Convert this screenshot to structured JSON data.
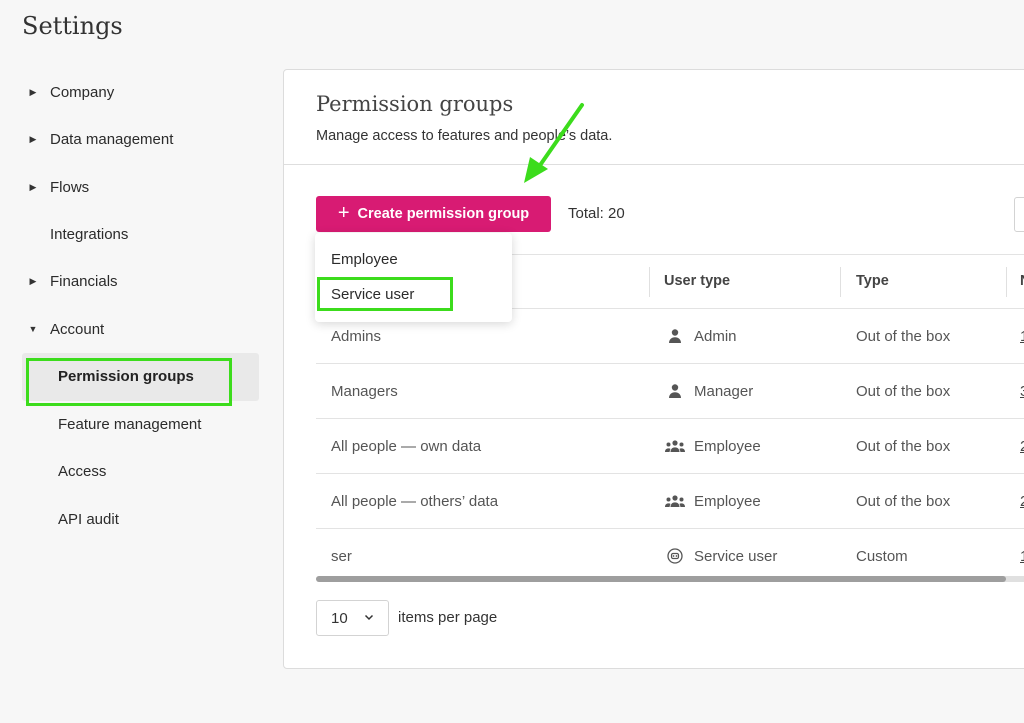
{
  "page": {
    "title": "Settings"
  },
  "sidebar": {
    "items": [
      {
        "label": "Company",
        "expandable": true
      },
      {
        "label": "Data management",
        "expandable": true
      },
      {
        "label": "Flows",
        "expandable": true
      },
      {
        "label": "Integrations",
        "expandable": false
      },
      {
        "label": "Financials",
        "expandable": true
      },
      {
        "label": "Account",
        "expandable": true,
        "expanded": true
      }
    ],
    "account_children": [
      {
        "label": "Permission groups",
        "active": true
      },
      {
        "label": "Feature management"
      },
      {
        "label": "Access"
      },
      {
        "label": "API audit"
      }
    ]
  },
  "panel": {
    "title": "Permission groups",
    "subtitle": "Manage access to features and people’s data.",
    "create_button": "Create permission group",
    "total": "Total: 20"
  },
  "dropdown": {
    "options": [
      "Employee",
      "Service user"
    ],
    "highlighted": "Service user"
  },
  "table": {
    "columns": [
      "User type",
      "Type",
      "N"
    ],
    "rows": [
      {
        "name": "Admins",
        "user_type": "Admin",
        "user_icon": "person-icon",
        "type": "Out of the box",
        "num": "1"
      },
      {
        "name": "Managers",
        "user_type": "Manager",
        "user_icon": "person-icon",
        "type": "Out of the box",
        "num": "3"
      },
      {
        "name": "All people — own data",
        "user_type": "Employee",
        "user_icon": "people-group-icon",
        "type": "Out of the box",
        "num": "2"
      },
      {
        "name": "All people — others’ data",
        "user_type": "Employee",
        "user_icon": "people-group-icon",
        "type": "Out of the box",
        "num": "2"
      },
      {
        "name": "ser",
        "user_type": "Service user",
        "user_icon": "robot-icon",
        "type": "Custom",
        "num": "1"
      }
    ]
  },
  "pagination": {
    "per_page": "10",
    "label": "items per page"
  },
  "colors": {
    "brand": "#d81b73",
    "highlight": "#3cdc1c"
  }
}
